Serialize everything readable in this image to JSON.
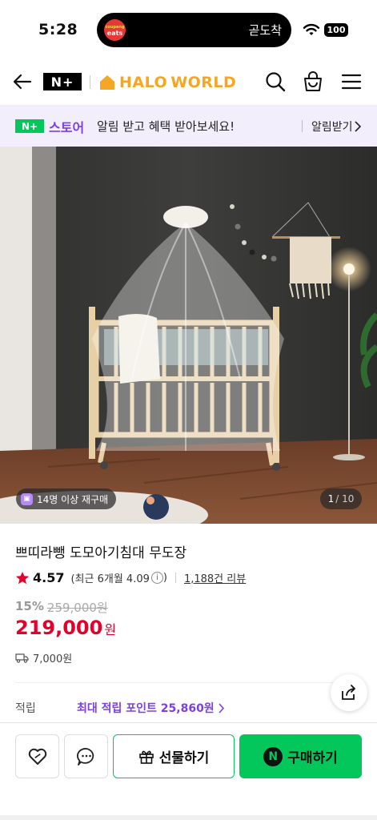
{
  "status_bar": {
    "time": "5:28",
    "live_activity_app_top": "coupang",
    "live_activity_app": "eats",
    "live_activity_text": "곧도착",
    "battery": "100"
  },
  "navbar": {
    "logo_nplus": "N+",
    "logo_halo": "HALO",
    "logo_world": "WORLD",
    "brand_color": "#f5a623"
  },
  "banner": {
    "badge": "N+",
    "store": "스토어",
    "message": "알림 받고 혜택 받아보세요!",
    "cta": "알림받기"
  },
  "hero": {
    "rebuy_badge": "14명 이상 재구매",
    "page_current": "1",
    "page_total": "/ 10"
  },
  "product": {
    "title": "쁘띠라뺑 도모아기침대 무도장",
    "rating": "4.57",
    "recent_rating": "(최근 6개월 4.09",
    "info_icon_label": "i",
    "recent_close": ")",
    "reviews": "1,188건 리뷰",
    "discount": "15%",
    "original_price": "259,000원",
    "price": "219,000",
    "currency": "원",
    "shipping": "7,000원",
    "points_label": "적립",
    "points_text": "최대 적립 포인트 25,860원"
  },
  "bottom_bar": {
    "gift_label": "선물하기",
    "buy_label": "구매하기",
    "buy_badge": "N"
  },
  "colors": {
    "naver_green": "#03c75a",
    "purple": "#7b3fe4",
    "price_red": "#e4002b"
  }
}
